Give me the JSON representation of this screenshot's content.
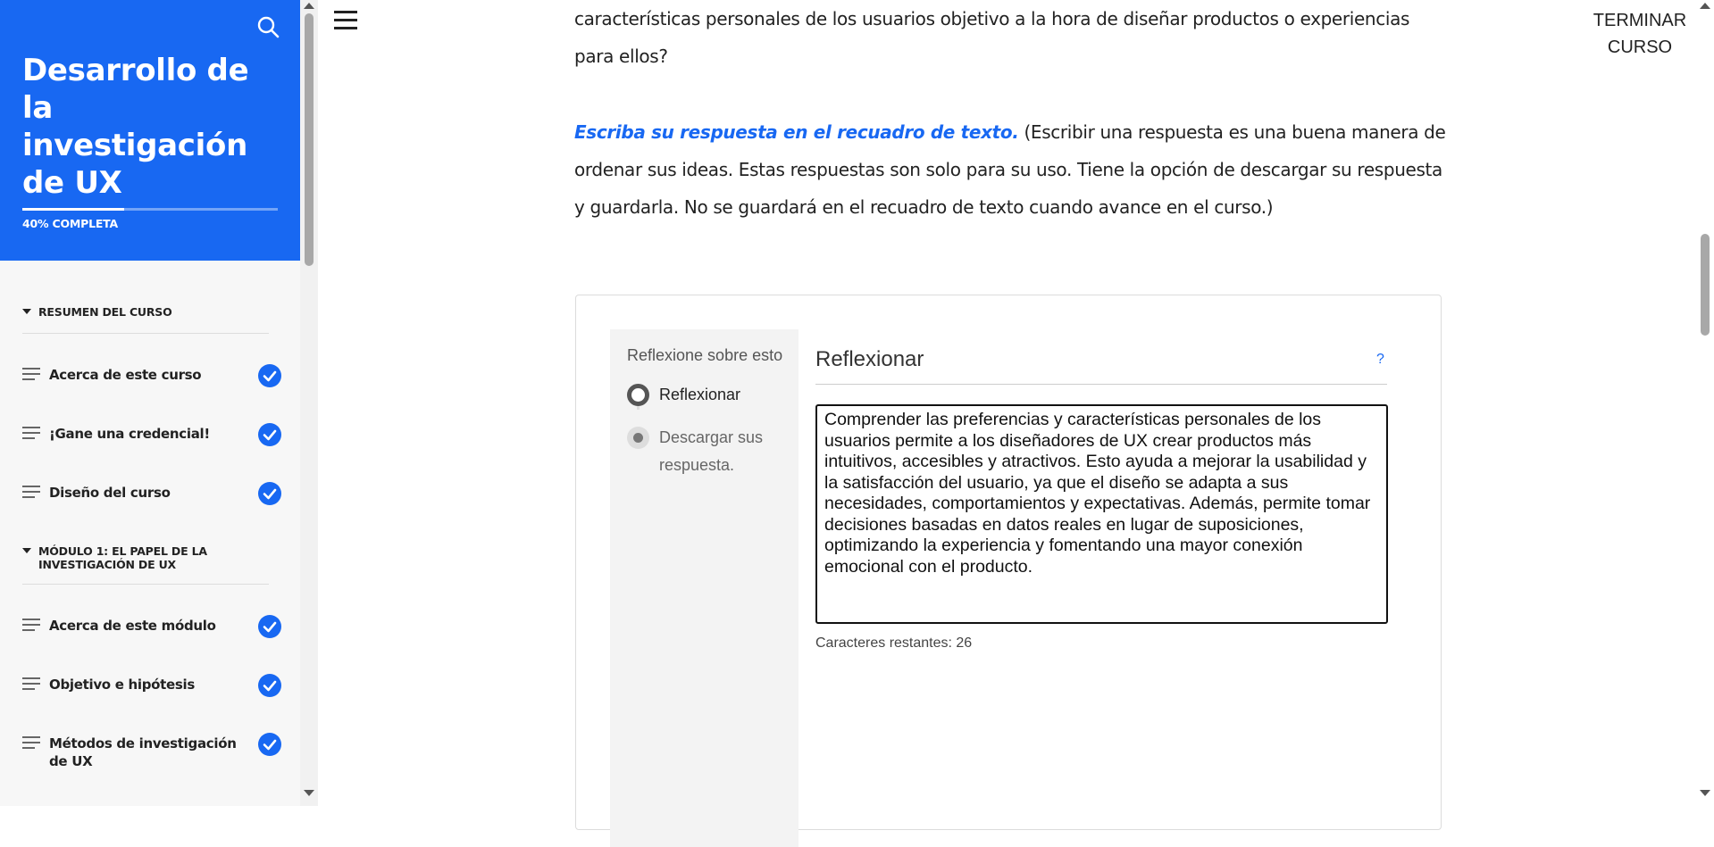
{
  "sidebar": {
    "course_title": "Desarrollo de la investigación de UX",
    "progress_label": "40% COMPLETA",
    "progress_percent": 40,
    "sections": [
      {
        "title": "RESUMEN DEL CURSO",
        "lessons": [
          {
            "label": "Acerca de este curso",
            "completed": true
          },
          {
            "label": "¡Gane una credencial!",
            "completed": true
          },
          {
            "label": "Diseño del curso",
            "completed": true
          }
        ]
      },
      {
        "title": "MÓDULO 1: EL PAPEL DE LA INVESTIGACIÓN DE UX",
        "lessons": [
          {
            "label": "Acerca de este módulo",
            "completed": true
          },
          {
            "label": "Objetivo e hipótesis",
            "completed": true
          },
          {
            "label": "Métodos de investigación de UX",
            "completed": true
          }
        ]
      }
    ],
    "icons": {
      "search": "search-icon",
      "lesson": "lesson-lines-icon",
      "completed": "checkmark-icon",
      "section_toggle": "caret-down-icon"
    }
  },
  "header": {
    "menu_icon": "hamburger-menu-icon",
    "exit_label_line1": "TERMINAR",
    "exit_label_line2": "CURSO"
  },
  "content": {
    "question_end_line1": "características personales de los usuarios objetivo a la hora de diseñar productos o experiencias",
    "question_end_line2": "para ellos?",
    "instruction_emphasis": "Escriba su respuesta en el recuadro de texto.",
    "instruction_line1_rest": " (Escribir una respuesta es una buena manera de",
    "instruction_line2": "ordenar sus ideas. Estas respuestas son solo para su uso. Tiene la opción de descargar su respuesta",
    "instruction_line3": "y guardarla. No se guardará en el recuadro de texto cuando avance en el curso.)"
  },
  "widget": {
    "side_title": "Reflexione sobre esto",
    "steps": [
      {
        "label": "Reflexionar",
        "state": "active"
      },
      {
        "label": "Descargar sus respuesta.",
        "state": "todo"
      }
    ],
    "title": "Reflexionar",
    "help_label": "?",
    "answer_text": "Comprender las preferencias y características personales de los usuarios permite a los diseñadores de UX crear productos más intuitivos, accesibles y atractivos. Esto ayuda a mejorar la usabilidad y la satisfacción del usuario, ya que el diseño se adapta a sus necesidades, comportamientos y expectativas. Además, permite tomar decisiones basadas en datos reales en lugar de suposiciones, optimizando la experiencia y fomentando una mayor conexión emocional con el producto.",
    "chars_remaining_label": "Caracteres restantes: 26"
  },
  "colors": {
    "brand_blue": "#1868f2",
    "sidebar_bg": "#f7f7f7",
    "text": "#222222"
  }
}
